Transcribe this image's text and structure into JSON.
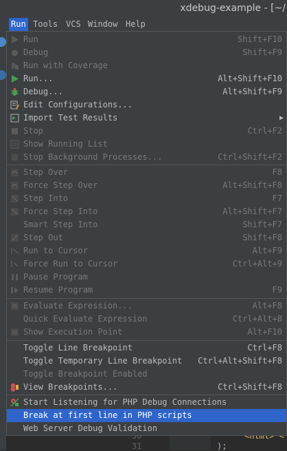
{
  "window": {
    "title": "xdebug-example - [~/"
  },
  "menubar": [
    {
      "label": "Run",
      "active": true
    },
    {
      "label": "Tools"
    },
    {
      "label": "VCS"
    },
    {
      "label": "Window"
    },
    {
      "label": "Help"
    }
  ],
  "menu": {
    "items": [
      {
        "label": "Run",
        "shortcut": "Shift+F10",
        "disabled": true,
        "icon": "run-icon"
      },
      {
        "label": "Debug",
        "shortcut": "Shift+F9",
        "disabled": true,
        "icon": "debug-icon"
      },
      {
        "label": "Run with Coverage",
        "shortcut": "",
        "disabled": true,
        "icon": "coverage-icon"
      },
      {
        "label": "Run...",
        "shortcut": "Alt+Shift+F10",
        "disabled": false,
        "icon": "run-icon"
      },
      {
        "label": "Debug...",
        "shortcut": "Alt+Shift+F9",
        "disabled": false,
        "icon": "debug-icon"
      },
      {
        "label": "Edit Configurations...",
        "shortcut": "",
        "disabled": false,
        "icon": "edit-config-icon"
      },
      {
        "label": "Import Test Results",
        "shortcut": "",
        "disabled": false,
        "icon": "import-icon",
        "submenu": true
      },
      {
        "label": "Stop",
        "shortcut": "Ctrl+F2",
        "disabled": true,
        "icon": "stop-icon"
      },
      {
        "label": "Show Running List",
        "shortcut": "",
        "disabled": true,
        "icon": "list-icon"
      },
      {
        "label": "Stop Background Processes...",
        "shortcut": "Ctrl+Shift+F2",
        "disabled": true,
        "icon": "stop-bg-icon"
      },
      {
        "label": "Step Over",
        "shortcut": "F8",
        "disabled": true,
        "icon": "step-over-icon"
      },
      {
        "label": "Force Step Over",
        "shortcut": "Alt+Shift+F8",
        "disabled": true,
        "icon": "force-step-over-icon"
      },
      {
        "label": "Step Into",
        "shortcut": "F7",
        "disabled": true,
        "icon": "step-into-icon"
      },
      {
        "label": "Force Step Into",
        "shortcut": "Alt+Shift+F7",
        "disabled": true,
        "icon": "force-step-into-icon"
      },
      {
        "label": "Smart Step Into",
        "shortcut": "Shift+F7",
        "disabled": true,
        "icon": ""
      },
      {
        "label": "Step Out",
        "shortcut": "Shift+F8",
        "disabled": true,
        "icon": "step-out-icon"
      },
      {
        "label": "Run to Cursor",
        "shortcut": "Alt+F9",
        "disabled": true,
        "icon": "run-to-cursor-icon"
      },
      {
        "label": "Force Run to Cursor",
        "shortcut": "Ctrl+Alt+9",
        "disabled": true,
        "icon": "force-run-to-cursor-icon"
      },
      {
        "label": "Pause Program",
        "shortcut": "",
        "disabled": true,
        "icon": "pause-icon"
      },
      {
        "label": "Resume Program",
        "shortcut": "F9",
        "disabled": true,
        "icon": "resume-icon"
      },
      {
        "label": "Evaluate Expression...",
        "shortcut": "Alt+F8",
        "disabled": true,
        "icon": "evaluate-icon"
      },
      {
        "label": "Quick Evaluate Expression",
        "shortcut": "Ctrl+Alt+8",
        "disabled": true,
        "icon": ""
      },
      {
        "label": "Show Execution Point",
        "shortcut": "Alt+F10",
        "disabled": true,
        "icon": "execution-point-icon"
      },
      {
        "label": "Toggle Line Breakpoint",
        "shortcut": "Ctrl+F8",
        "disabled": false,
        "icon": ""
      },
      {
        "label": "Toggle Temporary Line Breakpoint",
        "shortcut": "Ctrl+Alt+Shift+F8",
        "disabled": false,
        "icon": ""
      },
      {
        "label": "Toggle Breakpoint Enabled",
        "shortcut": "",
        "disabled": true,
        "icon": ""
      },
      {
        "label": "View Breakpoints...",
        "shortcut": "Ctrl+Shift+F8",
        "disabled": false,
        "icon": "breakpoints-icon"
      },
      {
        "label": "Start Listening for PHP Debug Connections",
        "shortcut": "",
        "disabled": false,
        "icon": "php-listen-icon"
      },
      {
        "label": "Break at first line in PHP scripts",
        "shortcut": "",
        "disabled": false,
        "icon": "",
        "selected": true
      },
      {
        "label": "Web Server Debug Validation",
        "shortcut": "",
        "disabled": false,
        "icon": ""
      }
    ]
  },
  "editor": {
    "line_numbers": [
      "30",
      "31"
    ],
    "code": [
      "<html> <",
      ");"
    ]
  }
}
